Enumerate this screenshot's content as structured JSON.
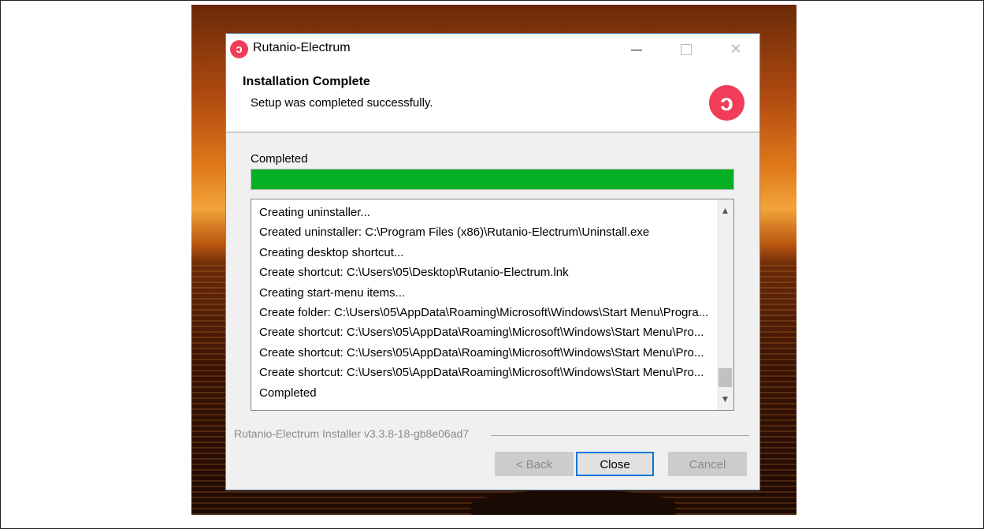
{
  "window": {
    "title": "Rutanio-Electrum",
    "app_icon_glyph": "ↄ",
    "accent_color": "#ef3d5a"
  },
  "header": {
    "title": "Installation Complete",
    "subtitle": "Setup was completed successfully."
  },
  "status": {
    "label": "Completed",
    "progress_percent": 100,
    "progress_color": "#06b025"
  },
  "log": {
    "lines": [
      "Creating uninstaller...",
      "Created uninstaller: C:\\Program Files (x86)\\Rutanio-Electrum\\Uninstall.exe",
      "Creating desktop shortcut...",
      "Create shortcut: C:\\Users\\05\\Desktop\\Rutanio-Electrum.lnk",
      "Creating start-menu items...",
      "Create folder: C:\\Users\\05\\AppData\\Roaming\\Microsoft\\Windows\\Start Menu\\Progra...",
      "Create shortcut: C:\\Users\\05\\AppData\\Roaming\\Microsoft\\Windows\\Start Menu\\Pro...",
      "Create shortcut: C:\\Users\\05\\AppData\\Roaming\\Microsoft\\Windows\\Start Menu\\Pro...",
      "Create shortcut: C:\\Users\\05\\AppData\\Roaming\\Microsoft\\Windows\\Start Menu\\Pro...",
      "Completed"
    ]
  },
  "footer": {
    "branding": "Rutanio-Electrum Installer v3.3.8-18-gb8e06ad7"
  },
  "buttons": {
    "back": "< Back",
    "close": "Close",
    "cancel": "Cancel"
  }
}
